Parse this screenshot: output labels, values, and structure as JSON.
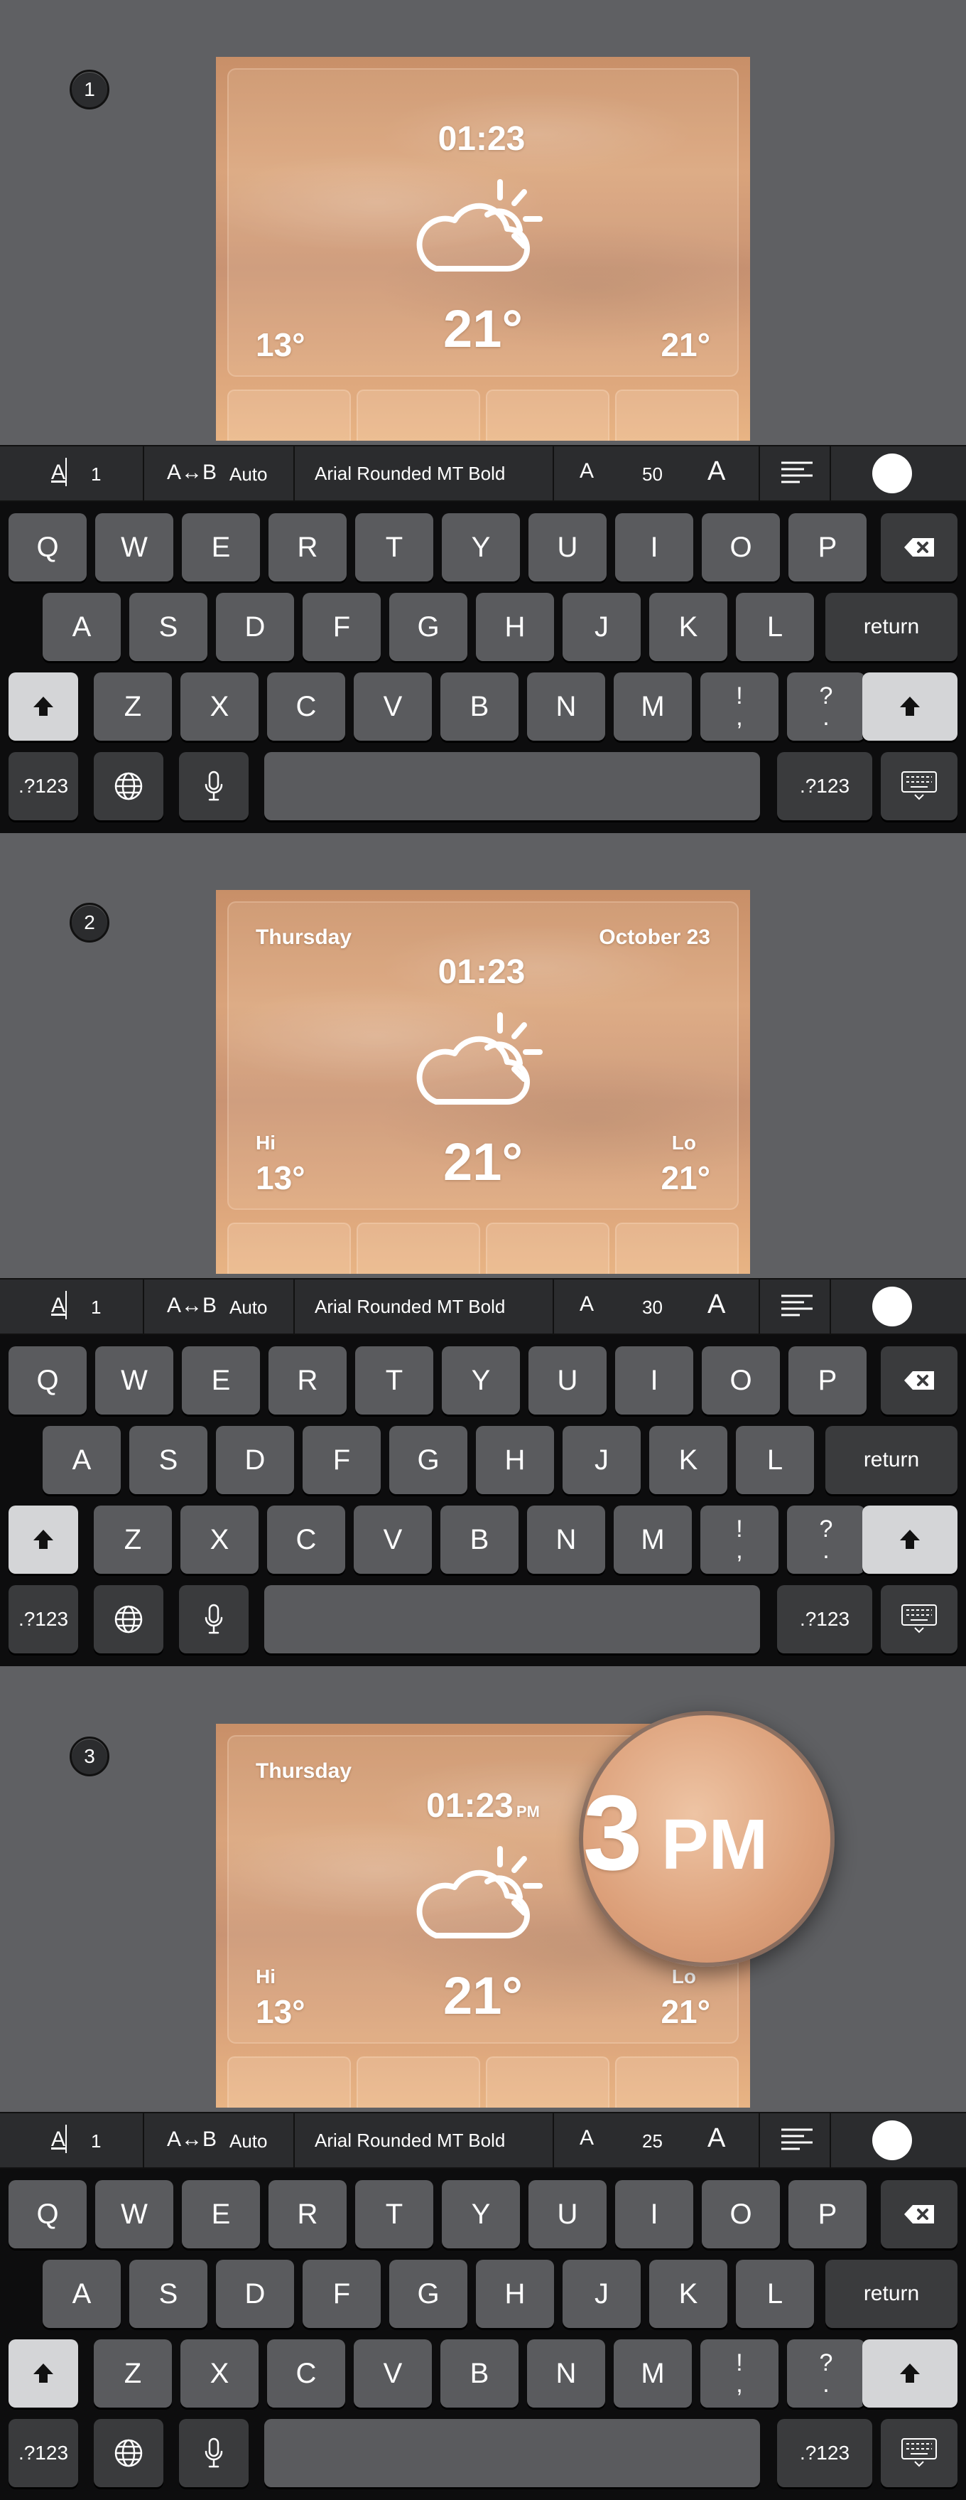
{
  "panels": [
    {
      "step": "1",
      "time": "01:23",
      "time_suffix": "",
      "temp": "21°",
      "low": "13°",
      "high": "21°",
      "hi_label": "",
      "lo_label": "",
      "day": "",
      "date": "",
      "font_size": "50",
      "magnifier": null
    },
    {
      "step": "2",
      "time": "01:23",
      "time_suffix": "",
      "temp": "21°",
      "low": "13°",
      "high": "21°",
      "hi_label": "Hi",
      "lo_label": "Lo",
      "day": "Thursday",
      "date": "October 23",
      "font_size": "30",
      "magnifier": null
    },
    {
      "step": "3",
      "time": "01:23",
      "time_suffix": "PM",
      "temp": "21°",
      "low": "13°",
      "high": "21°",
      "hi_label": "Hi",
      "lo_label": "Lo",
      "day": "Thursday",
      "date": "",
      "font_size": "25",
      "magnifier": {
        "big": "3",
        "pm": "PM"
      }
    }
  ],
  "toolbar": {
    "tracking_icon": "A",
    "tracking_value": "1",
    "case_label": "A↔B",
    "case_value": "Auto",
    "font_name": "Arial Rounded MT Bold",
    "size_small_a": "A",
    "size_large_a": "A",
    "align_icon": "align-left-icon",
    "color_swatch": "#ffffff"
  },
  "keyboard": {
    "row1": [
      "Q",
      "W",
      "E",
      "R",
      "T",
      "Y",
      "U",
      "I",
      "O",
      "P"
    ],
    "row2": [
      "A",
      "S",
      "D",
      "F",
      "G",
      "H",
      "J",
      "K",
      "L"
    ],
    "row3": [
      "Z",
      "X",
      "C",
      "V",
      "B",
      "N",
      "M"
    ],
    "punct1": "!",
    "punct1b": ",",
    "punct2": "?",
    "punct2b": ".",
    "return": "return",
    "numbers": ".?123"
  },
  "colors": {
    "background": "#5f6063",
    "keyboard": "#0d0d0e",
    "key": "#5a5b5e",
    "toolbar": "#2b2c2e"
  }
}
